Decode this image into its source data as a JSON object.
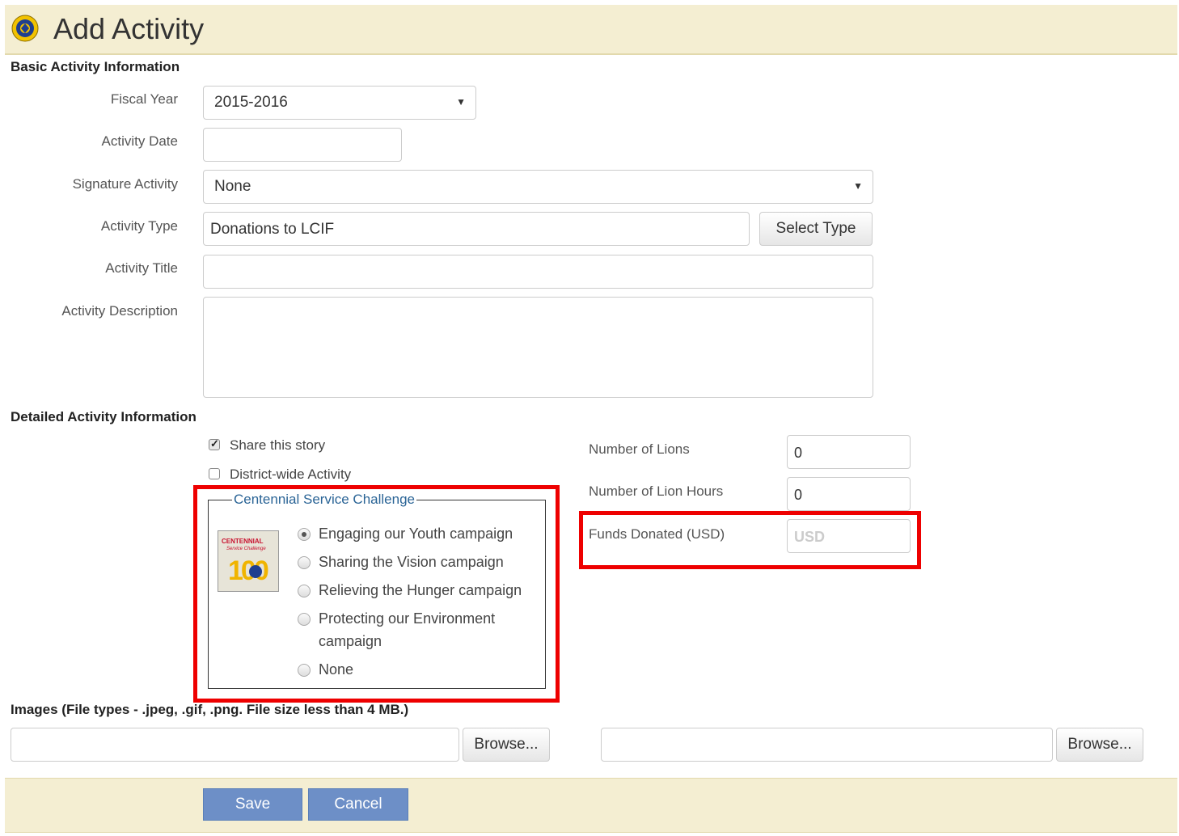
{
  "header": {
    "title": "Add Activity",
    "logo_icon": "lions-logo-icon"
  },
  "basic": {
    "section_title": "Basic Activity Information",
    "fiscal_year": {
      "label": "Fiscal Year",
      "value": "2015-2016"
    },
    "activity_date": {
      "label": "Activity Date",
      "value": ""
    },
    "signature_activity": {
      "label": "Signature Activity",
      "value": "None"
    },
    "activity_type": {
      "label": "Activity Type",
      "value": "Donations to LCIF",
      "button": "Select Type"
    },
    "activity_title": {
      "label": "Activity Title",
      "value": ""
    },
    "activity_description": {
      "label": "Activity Description",
      "value": ""
    }
  },
  "detailed": {
    "section_title": "Detailed Activity Information",
    "share_story": {
      "label": "Share this story",
      "checked": true
    },
    "district_wide": {
      "label": "District-wide Activity",
      "checked": false
    },
    "centennial": {
      "legend": "Centennial Service Challenge",
      "badge_text": "CENTENNIAL",
      "badge_subtext": "Service Challenge",
      "badge_number": "100",
      "options": [
        {
          "label": "Engaging our Youth campaign",
          "selected": true
        },
        {
          "label": "Sharing the Vision campaign",
          "selected": false
        },
        {
          "label": "Relieving the Hunger campaign",
          "selected": false
        },
        {
          "label": "Protecting our Environment campaign",
          "selected": false
        },
        {
          "label": "None",
          "selected": false
        }
      ]
    },
    "number_of_lions": {
      "label": "Number of Lions",
      "value": "0"
    },
    "lion_hours": {
      "label": "Number of Lion Hours",
      "value": "0"
    },
    "funds_donated": {
      "label": "Funds Donated (USD)",
      "placeholder": "USD"
    }
  },
  "images": {
    "section_title": "Images (File types - .jpeg, .gif, .png. File size less than 4 MB.)",
    "browse_label": "Browse..."
  },
  "footer": {
    "save_label": "Save",
    "cancel_label": "Cancel"
  },
  "colors": {
    "header_bg": "#f4eed2",
    "highlight": "#ee0000",
    "primary_button": "#6d8fc7",
    "legend_text": "#2a6496"
  }
}
